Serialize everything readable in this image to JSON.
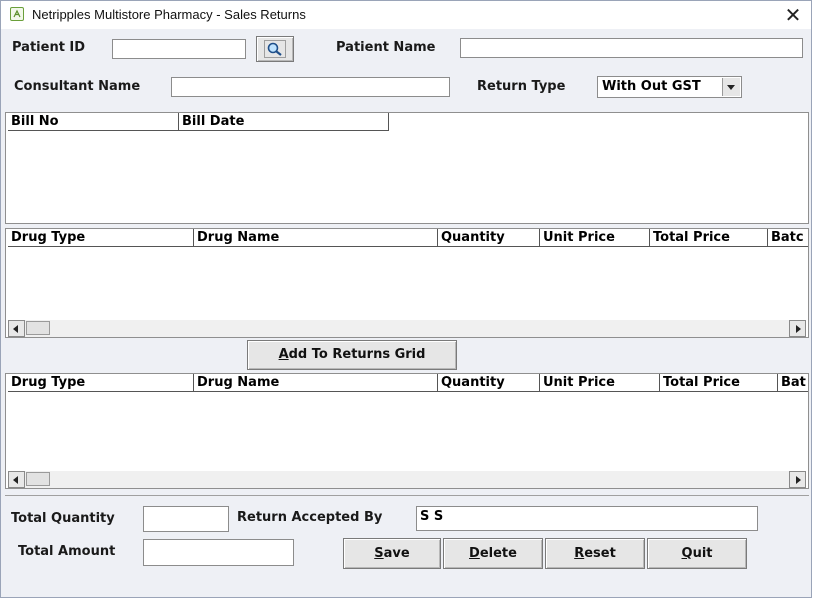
{
  "window": {
    "title": "Netripples Multistore Pharmacy - Sales Returns",
    "close": "✕"
  },
  "form": {
    "patient_id_label": "Patient ID",
    "patient_id_value": "",
    "patient_name_label": "Patient Name",
    "patient_name_value": "",
    "consultant_name_label": "Consultant Name",
    "consultant_name_value": "",
    "return_type_label": "Return Type",
    "return_type_value": "With Out GST"
  },
  "bills_grid": {
    "columns": [
      "Bill No",
      "Bill Date"
    ]
  },
  "drugs_grid": {
    "columns": [
      "Drug Type",
      "Drug Name",
      "Quantity",
      "Unit Price",
      "Total Price",
      "Batc"
    ]
  },
  "add_button": {
    "prefix": "A",
    "rest": "dd To Returns Grid"
  },
  "returns_grid": {
    "columns": [
      "Drug Type",
      "Drug Name",
      "Quantity",
      "Unit Price",
      "Total Price",
      "Bat"
    ]
  },
  "footer": {
    "total_quantity_label": "Total Quantity",
    "total_quantity_value": "",
    "return_accepted_by_label": "Return Accepted By",
    "return_accepted_by_value": "S S",
    "total_amount_label": "Total Amount",
    "total_amount_value": "",
    "save": {
      "prefix": "S",
      "rest": "ave"
    },
    "delete": {
      "prefix": "D",
      "rest": "elete"
    },
    "reset": {
      "prefix": "R",
      "rest": "eset"
    },
    "quit": {
      "prefix": "Q",
      "rest": "uit"
    }
  },
  "colors": {
    "window_bg": "#eef0f5",
    "grid_bg": "#ffffff",
    "border": "#8f8f8f"
  }
}
